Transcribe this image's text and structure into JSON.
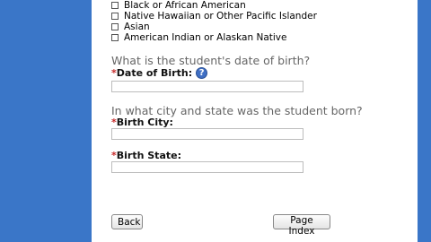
{
  "race_options": [
    "Black or African American",
    "Native Hawaiian or Other Pacific Islander",
    "Asian",
    "American Indian or Alaskan Native"
  ],
  "dob_section": {
    "question": "What is the student's date of birth?",
    "required_mark": "*",
    "label": "Date of Birth:",
    "help_icon": "question-icon",
    "help_glyph": "?",
    "value": ""
  },
  "birth_place_section": {
    "question": "In what city and state was the student born?",
    "city_label": "Birth City:",
    "city_value": "",
    "state_label": "Birth State:",
    "state_value": ""
  },
  "buttons": {
    "back": "Back",
    "page_index": "Page Index"
  },
  "colors": {
    "side_band": "#3a76c8",
    "required": "#c62828",
    "question_text": "#666666"
  }
}
